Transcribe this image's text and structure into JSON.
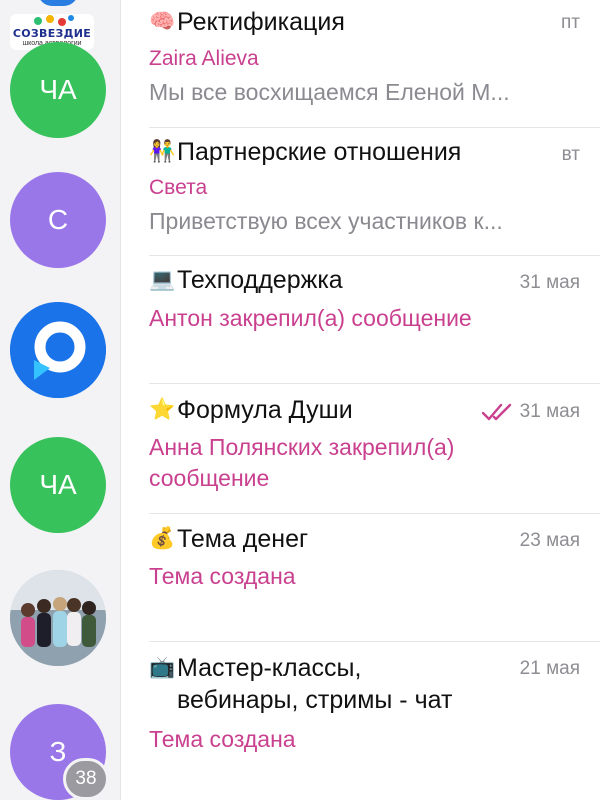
{
  "logo": {
    "title": "СОЗВЕЗДИЕ",
    "subtitle": "школа астрологии",
    "dot_colors": [
      "#2fbf71",
      "#f4b400",
      "#e53935",
      "#1e88e5"
    ]
  },
  "rail": {
    "avatars": [
      {
        "initials": "ЧА",
        "color": "#37c25c"
      },
      {
        "initials": "С",
        "color": "#9a77e9"
      },
      {
        "initials": "",
        "color": "#1a73e8",
        "icon": "messenger-logo-icon"
      },
      {
        "initials": "ЧА",
        "color": "#37c25c"
      },
      {
        "initials": "",
        "icon": "group-photo"
      },
      {
        "initials": "З",
        "color": "#9a77e9",
        "badge": "38"
      }
    ]
  },
  "chats": [
    {
      "emoji": "🧠",
      "title": "Ректификация",
      "time": "пт",
      "sender": "Zaira Alieva",
      "preview": "Мы все восхищаемся Еленой М..."
    },
    {
      "emoji": "👫",
      "title": "Партнерские отношения",
      "time": "вт",
      "sender": "Света",
      "preview": "Приветствую всех участников к..."
    },
    {
      "emoji": "💻",
      "title": "Техподдержка",
      "time": "31 мая",
      "action": "Антон закрепил(а) сообщение"
    },
    {
      "emoji": "⭐",
      "title": "Формула Души",
      "time": "31 мая",
      "read": true,
      "action": "Анна Полянских закрепил(а) сообщение"
    },
    {
      "emoji": "💰",
      "title": "Тема денег",
      "time": "23 мая",
      "action": "Тема создана"
    },
    {
      "emoji": "📺",
      "title": "Мастер-классы, вебинары, стримы - чат",
      "time": "21 мая",
      "action": "Тема создана"
    }
  ],
  "colors": {
    "accent_pink": "#c9408f",
    "read_check": "#c9408f",
    "muted_text": "#8a8a90"
  }
}
